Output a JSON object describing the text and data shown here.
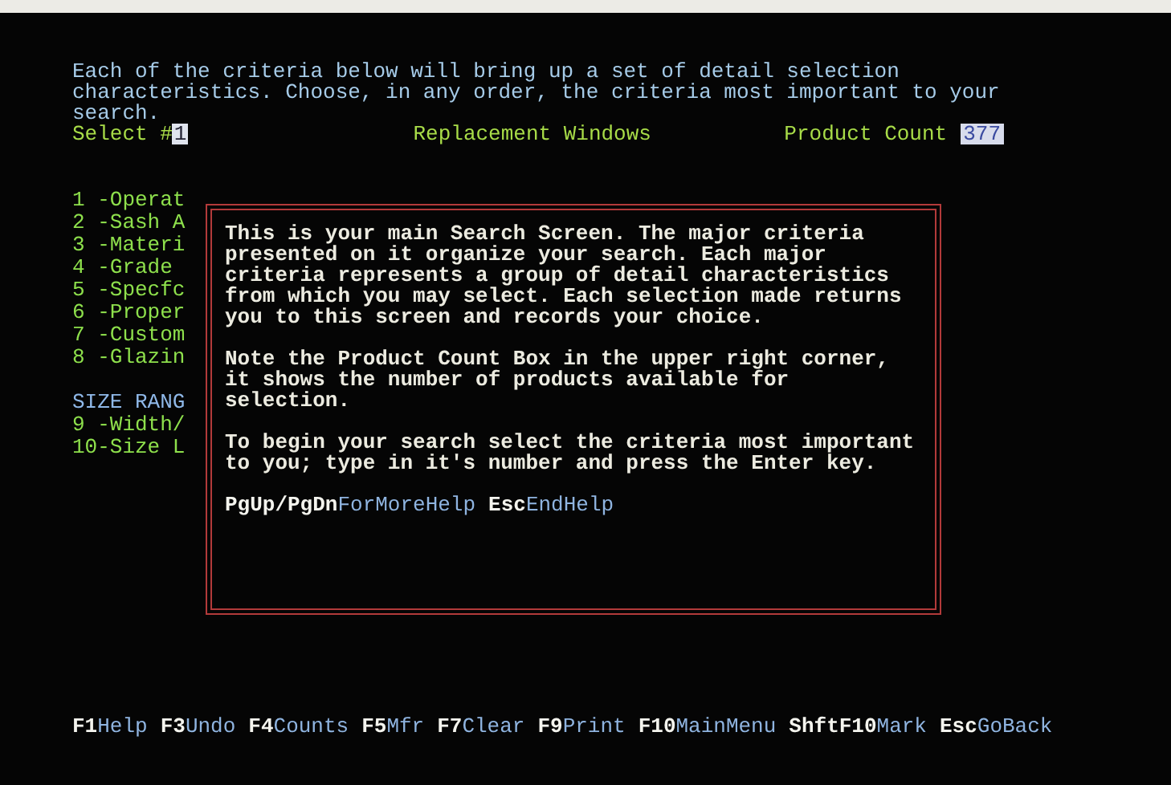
{
  "intro": [
    "Each of the criteria below will bring up a set of detail selection",
    "characteristics. Choose, in any order, the criteria most important to your",
    "search."
  ],
  "select": {
    "label": "Select #",
    "value": "1"
  },
  "title": "Replacement Windows",
  "product_count": {
    "label": "Product Count",
    "value": "377"
  },
  "menu": [
    {
      "kind": "option",
      "text": "1 -Operat"
    },
    {
      "kind": "option",
      "text": "2 -Sash A"
    },
    {
      "kind": "option",
      "text": "3 -Materi"
    },
    {
      "kind": "option",
      "text": "4 -Grade"
    },
    {
      "kind": "option",
      "text": "5 -Specfc"
    },
    {
      "kind": "option",
      "text": "6 -Proper"
    },
    {
      "kind": "option",
      "text": "7 -Custom"
    },
    {
      "kind": "option",
      "text": "8 -Glazin"
    },
    {
      "kind": "gap"
    },
    {
      "kind": "heading",
      "text": "SIZE RANG"
    },
    {
      "kind": "option",
      "text": "9 -Width/"
    },
    {
      "kind": "option",
      "text": "10-Size L"
    }
  ],
  "help": {
    "paragraphs": [
      [
        "This is your main Search Screen. The major criteria",
        "presented on it organize your search. Each major",
        "criteria represents a group of detail characteristics",
        "from which you may select. Each selection made returns",
        "you to this screen and records your choice."
      ],
      [
        "Note the Product Count Box in the upper right corner,",
        "it shows the number of products available for",
        "selection."
      ],
      [
        "To begin your search select the criteria most important",
        "to you; type in it's number and press the Enter key."
      ]
    ],
    "keys": [
      {
        "key": "PgUp/PgDn",
        "label": "ForMoreHelp"
      },
      {
        "key": "Esc",
        "label": "EndHelp"
      }
    ]
  },
  "function_keys": [
    {
      "key": "F1",
      "label": "Help"
    },
    {
      "key": "F3",
      "label": "Undo"
    },
    {
      "key": "F4",
      "label": "Counts"
    },
    {
      "key": "F5",
      "label": "Mfr"
    },
    {
      "key": "F7",
      "label": "Clear"
    },
    {
      "key": "F9",
      "label": "Print"
    },
    {
      "key": "F10",
      "label": "MainMenu"
    },
    {
      "key": "ShftF10",
      "label": "Mark"
    },
    {
      "key": "Esc",
      "label": "GoBack"
    }
  ]
}
